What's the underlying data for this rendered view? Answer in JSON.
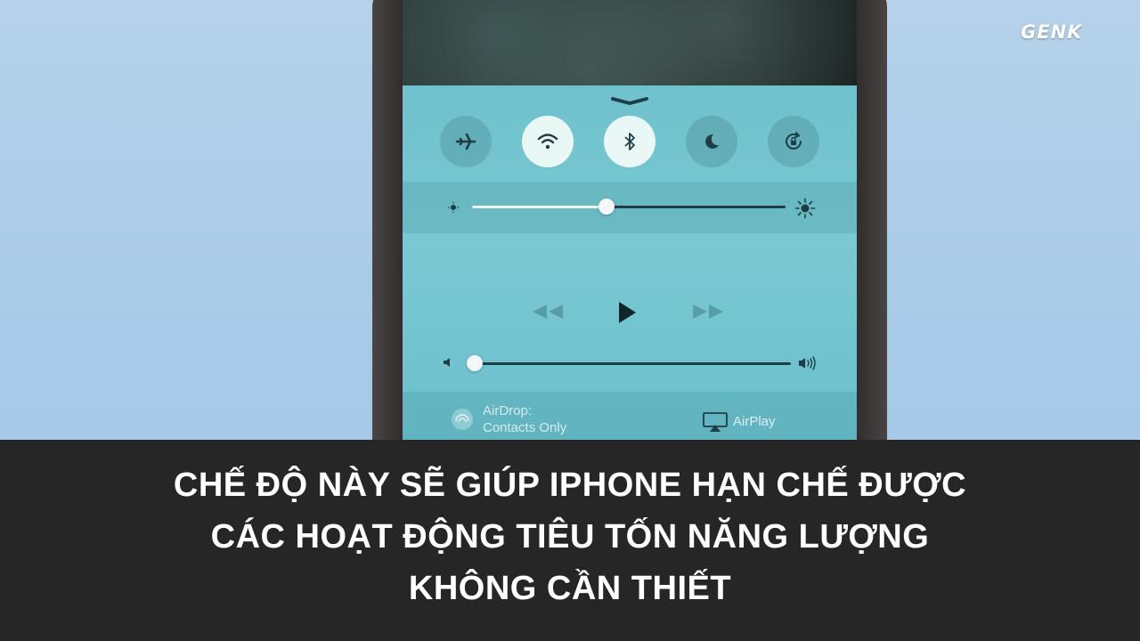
{
  "brand": {
    "logo_text": "GENK"
  },
  "control_center": {
    "toggles": [
      {
        "name": "airplane-mode",
        "icon": "airplane-icon",
        "on": false
      },
      {
        "name": "wifi",
        "icon": "wifi-icon",
        "on": true
      },
      {
        "name": "bluetooth",
        "icon": "bluetooth-icon",
        "on": true
      },
      {
        "name": "do-not-disturb",
        "icon": "moon-icon",
        "on": false
      },
      {
        "name": "rotation-lock",
        "icon": "rotation-lock-icon",
        "on": false
      }
    ],
    "brightness_level": 0.43,
    "volume_level": 0.0,
    "media": {
      "icons": [
        "rewind-icon",
        "play-icon",
        "fast-forward-icon"
      ]
    },
    "airdrop": {
      "line1": "AirDrop:",
      "line2": "Contacts Only"
    },
    "airplay": {
      "label": "AirPlay"
    }
  },
  "caption": {
    "line1": "CHẾ ĐỘ NÀY SẼ GIÚP IPHONE HẠN CHẾ ĐƯỢC",
    "line2": "CÁC HOẠT ĐỘNG TIÊU TỐN NĂNG LƯỢNG",
    "line3": "KHÔNG CẦN THIẾT"
  },
  "colors": {
    "sky": "#a9cbe9",
    "control_center": "#6fc1cd",
    "caption_bar": "#262626",
    "caption_text": "#ffffff"
  }
}
